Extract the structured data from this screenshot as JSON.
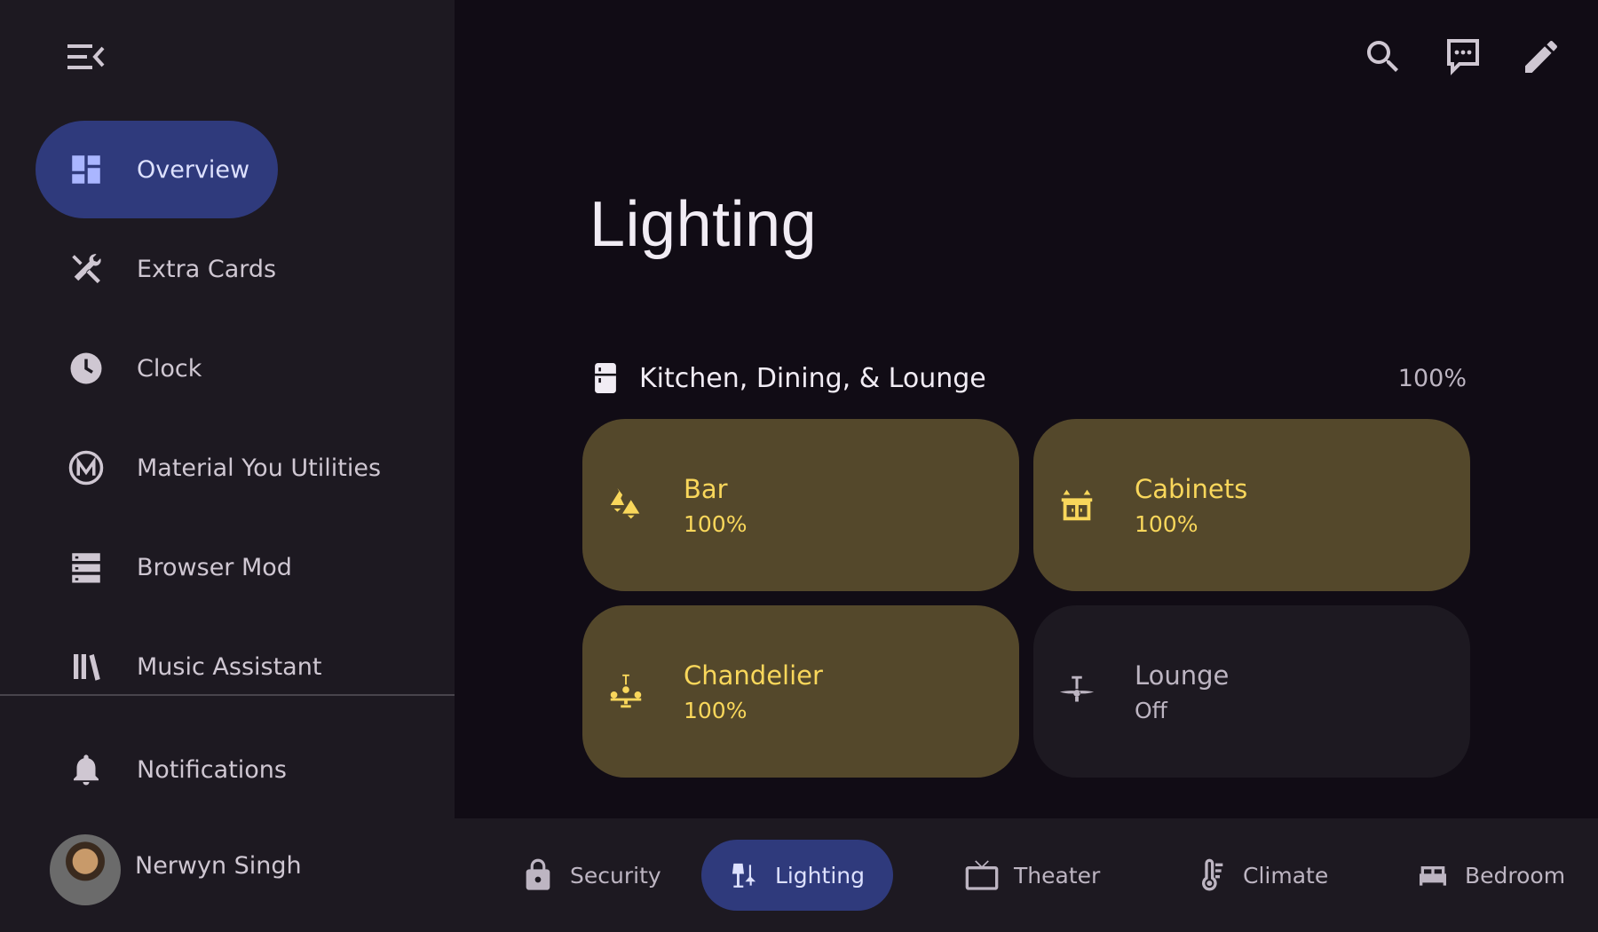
{
  "colors": {
    "background": "#110c15",
    "sidebar": "#1d1921",
    "active_nav": "#2f3a7c",
    "tile_on": "#54482b",
    "tile_on_text": "#f9d75b",
    "tile_off": "#1d1921"
  },
  "sidebar": {
    "menu_icon": "menu-open-icon",
    "items": [
      {
        "label": "Overview",
        "icon": "dashboard-icon",
        "active": true
      },
      {
        "label": "Extra Cards",
        "icon": "tools-icon"
      },
      {
        "label": "Clock",
        "icon": "clock-icon"
      },
      {
        "label": "Material You Utilities",
        "icon": "material-m-icon"
      },
      {
        "label": "Browser Mod",
        "icon": "server-icon"
      },
      {
        "label": "Music Assistant",
        "icon": "library-icon"
      }
    ],
    "notifications_label": "Notifications",
    "user_name": "Nerwyn Singh"
  },
  "toolbar": {
    "icons": [
      "search-icon",
      "assist-icon",
      "edit-icon"
    ]
  },
  "main": {
    "title": "Lighting",
    "room": {
      "name": "Kitchen, Dining, & Lounge",
      "brightness": "100%",
      "tiles": [
        {
          "name": "Bar",
          "state": "100%",
          "on": true,
          "icon": "ceiling-lights-icon"
        },
        {
          "name": "Cabinets",
          "state": "100%",
          "on": true,
          "icon": "cabinet-light-icon"
        },
        {
          "name": "Chandelier",
          "state": "100%",
          "on": true,
          "icon": "chandelier-icon"
        },
        {
          "name": "Lounge",
          "state": "Off",
          "on": false,
          "icon": "ceiling-fan-light-icon"
        }
      ]
    }
  },
  "bottom_nav": [
    {
      "label": "Security",
      "icon": "lock-icon"
    },
    {
      "label": "Lighting",
      "icon": "lamps-icon",
      "active": true
    },
    {
      "label": "Theater",
      "icon": "tv-icon"
    },
    {
      "label": "Climate",
      "icon": "thermometer-icon"
    },
    {
      "label": "Bedroom",
      "icon": "bed-icon"
    }
  ]
}
